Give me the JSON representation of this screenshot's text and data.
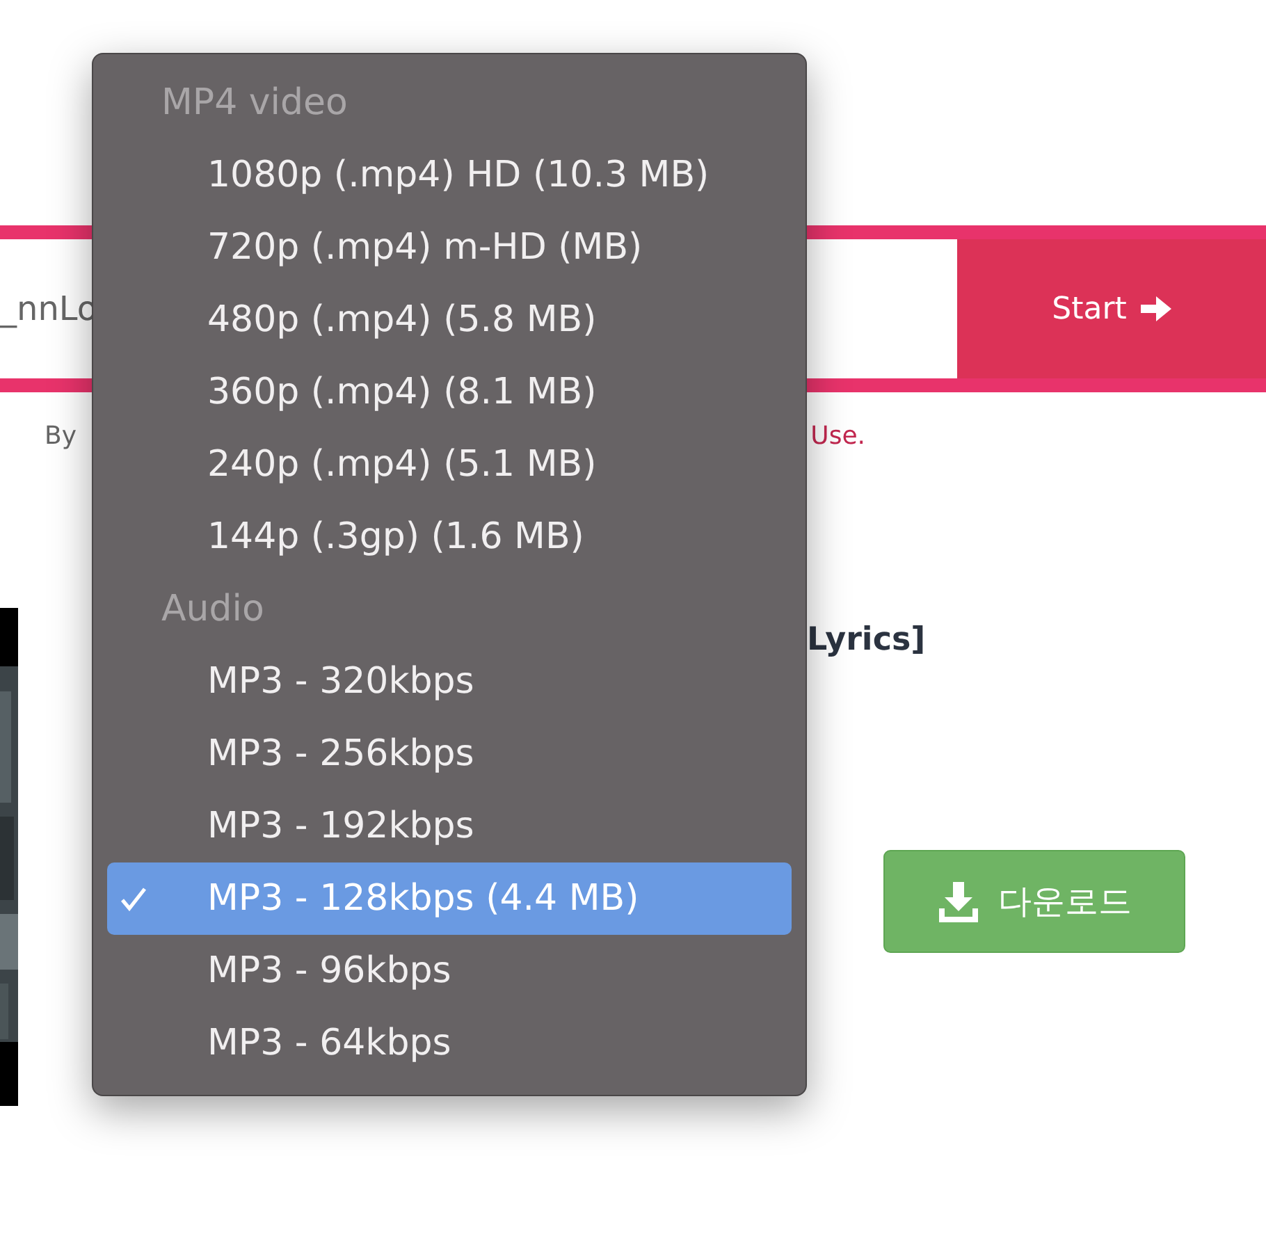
{
  "url_field": {
    "value": "_nnLo"
  },
  "start_button": {
    "label": "Start"
  },
  "terms": {
    "lead": "By",
    "link": "Use."
  },
  "video": {
    "title": "Lyrics]"
  },
  "download_button": {
    "label": "다운로드"
  },
  "format_menu": {
    "groups": [
      {
        "label": "MP4 video",
        "options": [
          {
            "label": "1080p (.mp4) HD (10.3 MB)",
            "selected": false
          },
          {
            "label": "720p (.mp4) m-HD (MB)",
            "selected": false
          },
          {
            "label": "480p (.mp4) (5.8 MB)",
            "selected": false
          },
          {
            "label": "360p (.mp4) (8.1 MB)",
            "selected": false
          },
          {
            "label": "240p (.mp4) (5.1 MB)",
            "selected": false
          },
          {
            "label": "144p (.3gp) (1.6 MB)",
            "selected": false
          }
        ]
      },
      {
        "label": "Audio",
        "options": [
          {
            "label": "MP3 - 320kbps",
            "selected": false
          },
          {
            "label": "MP3 - 256kbps",
            "selected": false
          },
          {
            "label": "MP3 - 192kbps",
            "selected": false
          },
          {
            "label": "MP3 - 128kbps (4.4 MB)",
            "selected": true
          },
          {
            "label": "MP3 - 96kbps",
            "selected": false
          },
          {
            "label": "MP3 - 64kbps",
            "selected": false
          }
        ]
      }
    ]
  }
}
